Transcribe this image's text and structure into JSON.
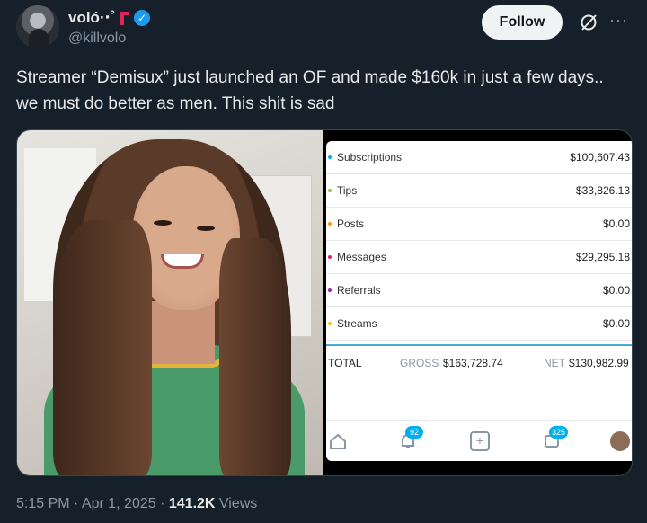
{
  "author": {
    "display_name": "voló·‧˚",
    "handle": "@killvolo",
    "verified_mark": "✓"
  },
  "actions": {
    "follow_label": "Follow",
    "more_label": "···"
  },
  "tweet": {
    "text": "Streamer “Demisux”  just launched an OF and made $160k in just a few days.. we must do better as men. This shit is sad"
  },
  "earnings": {
    "rows": [
      {
        "label": "Subscriptions",
        "amount": "$100,607.43",
        "color": "#00aff0"
      },
      {
        "label": "Tips",
        "amount": "$33,826.13",
        "color": "#8bc34a"
      },
      {
        "label": "Posts",
        "amount": "$0.00",
        "color": "#ff9800"
      },
      {
        "label": "Messages",
        "amount": "$29,295.18",
        "color": "#e91e63"
      },
      {
        "label": "Referrals",
        "amount": "$0.00",
        "color": "#9c27b0"
      },
      {
        "label": "Streams",
        "amount": "$0.00",
        "color": "#ffc107"
      }
    ],
    "total_label": "TOTAL",
    "gross_label": "GROSS",
    "gross_value": "$163,728.74",
    "net_label": "NET",
    "net_value": "$130,982.99"
  },
  "tabbar": {
    "notifications_badge": "92",
    "messages_badge": "325",
    "plus_glyph": "+"
  },
  "meta": {
    "time": "5:15 PM · Apr 1, 2025 · ",
    "views_count": "141.2K",
    "views_label": " Views"
  }
}
